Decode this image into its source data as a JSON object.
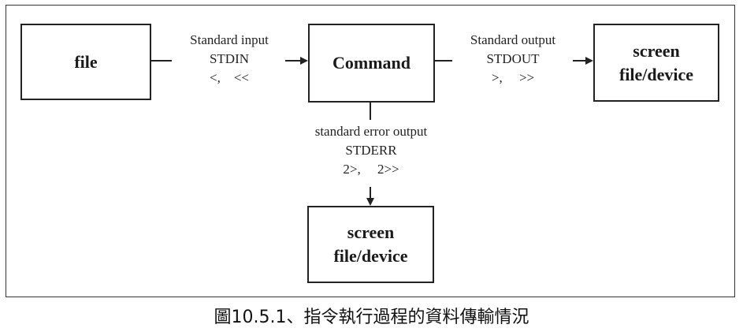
{
  "boxes": {
    "file": {
      "line1": "file"
    },
    "command": {
      "line1": "Command"
    },
    "stdout_target": {
      "line1": "screen",
      "line2": "file/device"
    },
    "stderr_target": {
      "line1": "screen",
      "line2": "file/device"
    }
  },
  "labels": {
    "stdin": {
      "line1": "Standard input",
      "line2": "STDIN",
      "line3": "<,    <<"
    },
    "stdout": {
      "line1": "Standard output",
      "line2": "STDOUT",
      "line3": ">,     >>"
    },
    "stderr": {
      "line1": "standard error output",
      "line2": "STDERR",
      "line3": "2>,     2>>"
    }
  },
  "caption": "圖10.5.1、指令執行過程的資料傳輸情況"
}
